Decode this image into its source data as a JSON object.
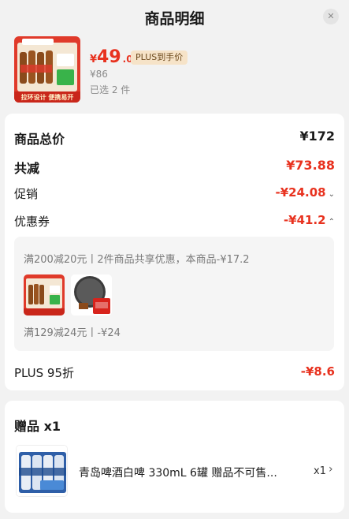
{
  "header": {
    "title": "商品明细",
    "close_icon": "close-icon ×"
  },
  "product": {
    "image": "tsingtao-beer-pack-image",
    "image_banner_text": "拉环设计 便携易开",
    "price_symbol": "¥",
    "price_int": "49",
    "price_dec": ".06",
    "plus_tag": "PLUS到手价",
    "original_price": "¥86",
    "selected_count": "已选 2 件"
  },
  "summary": {
    "total_label": "商品总价",
    "total_value": "¥172",
    "reduce_label": "共减",
    "reduce_value": "¥73.88",
    "promo_label": "促销",
    "promo_value": "-¥24.08",
    "coupon_label": "优惠券",
    "coupon_value": "-¥41.2",
    "coupon_details": {
      "line1": "满200减20元丨2件商品共享优惠，本商品-¥17.2",
      "line2": "满129减24元丨-¥24"
    },
    "plus_label": "PLUS 95折",
    "plus_value": "-¥8.6"
  },
  "gift": {
    "title": "赠品 x1",
    "name": "青岛啤酒白啤 330mL 6罐 赠品不可售...",
    "qty": "x1"
  },
  "colors": {
    "accent_red": "#e8321f",
    "plus_tag_bg": "#f6e3c8",
    "page_bg": "#f2f2f2",
    "card_bg": "#ffffff"
  }
}
